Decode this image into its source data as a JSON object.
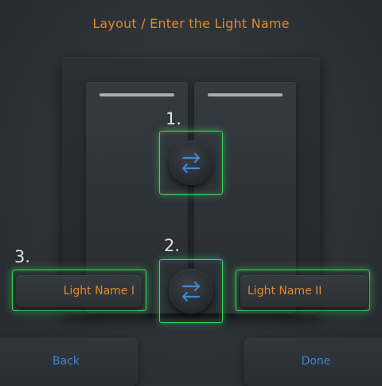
{
  "header": {
    "title": "Layout / Enter the Light Name"
  },
  "steps": {
    "step1": "1.",
    "step2": "2.",
    "step3": "3."
  },
  "switch_plate": {
    "swap_buttons": [
      {
        "icon": "swap-arrows-icon"
      },
      {
        "icon": "swap-arrows-icon"
      }
    ]
  },
  "name_fields": {
    "light_1": "Light Name I",
    "light_2": "Light Name II"
  },
  "footer": {
    "back_label": "Back",
    "done_label": "Done"
  },
  "colors": {
    "accent_orange": "#e08a2c",
    "accent_blue": "#3d86d2",
    "highlight_green": "#3fd35b",
    "background": "#2d3238"
  }
}
